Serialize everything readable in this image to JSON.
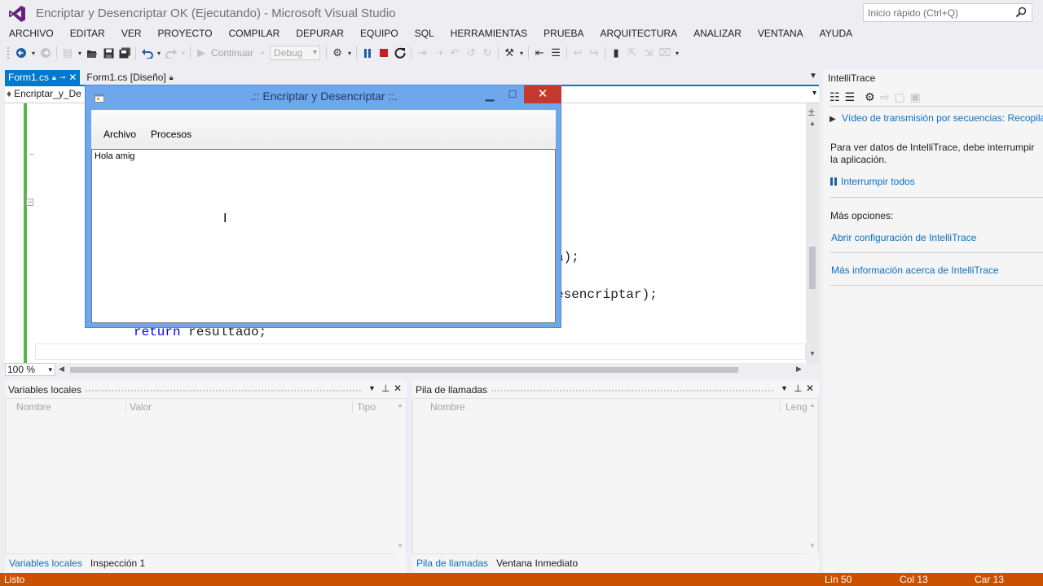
{
  "window": {
    "title": "Encriptar y Desencriptar OK (Ejecutando) - Microsoft Visual Studio",
    "quick_launch_placeholder": "Inicio rápido (Ctrl+Q)"
  },
  "menu": [
    "ARCHIVO",
    "EDITAR",
    "VER",
    "PROYECTO",
    "COMPILAR",
    "DEPURAR",
    "EQUIPO",
    "SQL",
    "HERRAMIENTAS",
    "PRUEBA",
    "ARQUITECTURA",
    "ANALIZAR",
    "VENTANA",
    "AYUDA"
  ],
  "toolbar": {
    "continue_label": "Continuar",
    "config_value": "Debug"
  },
  "tabs": [
    {
      "label": "Form1.cs"
    },
    {
      "label": "Form1.cs [Diseño]"
    }
  ],
  "navbar": {
    "class_label": "Encriptar_y_De"
  },
  "editor": {
    "line_a": "a);",
    "line_b": "esencriptar);",
    "line_return_kw": "return",
    "line_return_rest": " resultado;",
    "zoom": "100 %"
  },
  "form": {
    "title": ".:: Encriptar y Desencriptar ::.",
    "menu": [
      "Archivo",
      "Procesos"
    ],
    "textbox_value": "Hola amig"
  },
  "intellitrace": {
    "title": "IntelliTrace",
    "video_link": "Vídeo de transmisión por secuencias: Recopila",
    "message": "Para ver datos de IntelliTrace, debe interrumpir la aplicación.",
    "break_all": "Interrumpir todos",
    "more_options": "Más opciones:",
    "open_config": "Abrir configuración de IntelliTrace",
    "more_info": "Más información acerca de IntelliTrace"
  },
  "locals": {
    "title": "Variables locales",
    "columns": [
      "Nombre",
      "Valor",
      "Tipo"
    ],
    "tabs": [
      "Variables locales",
      "Inspección 1"
    ]
  },
  "callstack": {
    "title": "Pila de llamadas",
    "columns": [
      "Nombre",
      "Leng"
    ],
    "tabs": [
      "Pila de llamadas",
      "Ventana Inmediato"
    ]
  },
  "status": {
    "text": "Listo",
    "ln": "Lín 50",
    "col": "Col 13",
    "car": "Car 13"
  },
  "colors": {
    "accent": "#007acc",
    "status_bar": "#ca5100",
    "form_title": "#6ea7ec",
    "close_button": "#c7382f",
    "link": "#0e70c0"
  }
}
